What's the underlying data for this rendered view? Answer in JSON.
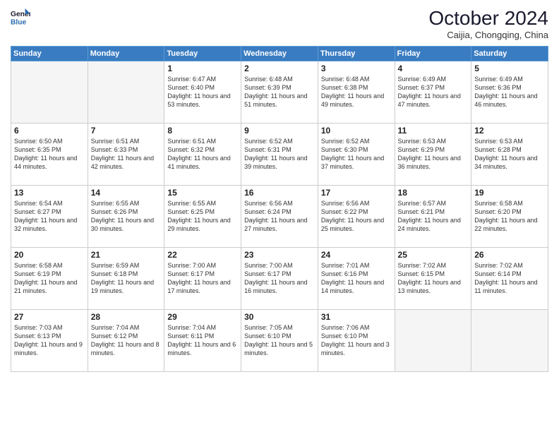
{
  "logo": {
    "line1": "General",
    "line2": "Blue"
  },
  "title": "October 2024",
  "subtitle": "Caijia, Chongqing, China",
  "days_header": [
    "Sunday",
    "Monday",
    "Tuesday",
    "Wednesday",
    "Thursday",
    "Friday",
    "Saturday"
  ],
  "weeks": [
    [
      {
        "day": "",
        "empty": true
      },
      {
        "day": "",
        "empty": true
      },
      {
        "day": "1",
        "sunrise": "Sunrise: 6:47 AM",
        "sunset": "Sunset: 6:40 PM",
        "daylight": "Daylight: 11 hours and 53 minutes."
      },
      {
        "day": "2",
        "sunrise": "Sunrise: 6:48 AM",
        "sunset": "Sunset: 6:39 PM",
        "daylight": "Daylight: 11 hours and 51 minutes."
      },
      {
        "day": "3",
        "sunrise": "Sunrise: 6:48 AM",
        "sunset": "Sunset: 6:38 PM",
        "daylight": "Daylight: 11 hours and 49 minutes."
      },
      {
        "day": "4",
        "sunrise": "Sunrise: 6:49 AM",
        "sunset": "Sunset: 6:37 PM",
        "daylight": "Daylight: 11 hours and 47 minutes."
      },
      {
        "day": "5",
        "sunrise": "Sunrise: 6:49 AM",
        "sunset": "Sunset: 6:36 PM",
        "daylight": "Daylight: 11 hours and 46 minutes."
      }
    ],
    [
      {
        "day": "6",
        "sunrise": "Sunrise: 6:50 AM",
        "sunset": "Sunset: 6:35 PM",
        "daylight": "Daylight: 11 hours and 44 minutes."
      },
      {
        "day": "7",
        "sunrise": "Sunrise: 6:51 AM",
        "sunset": "Sunset: 6:33 PM",
        "daylight": "Daylight: 11 hours and 42 minutes."
      },
      {
        "day": "8",
        "sunrise": "Sunrise: 6:51 AM",
        "sunset": "Sunset: 6:32 PM",
        "daylight": "Daylight: 11 hours and 41 minutes."
      },
      {
        "day": "9",
        "sunrise": "Sunrise: 6:52 AM",
        "sunset": "Sunset: 6:31 PM",
        "daylight": "Daylight: 11 hours and 39 minutes."
      },
      {
        "day": "10",
        "sunrise": "Sunrise: 6:52 AM",
        "sunset": "Sunset: 6:30 PM",
        "daylight": "Daylight: 11 hours and 37 minutes."
      },
      {
        "day": "11",
        "sunrise": "Sunrise: 6:53 AM",
        "sunset": "Sunset: 6:29 PM",
        "daylight": "Daylight: 11 hours and 36 minutes."
      },
      {
        "day": "12",
        "sunrise": "Sunrise: 6:53 AM",
        "sunset": "Sunset: 6:28 PM",
        "daylight": "Daylight: 11 hours and 34 minutes."
      }
    ],
    [
      {
        "day": "13",
        "sunrise": "Sunrise: 6:54 AM",
        "sunset": "Sunset: 6:27 PM",
        "daylight": "Daylight: 11 hours and 32 minutes."
      },
      {
        "day": "14",
        "sunrise": "Sunrise: 6:55 AM",
        "sunset": "Sunset: 6:26 PM",
        "daylight": "Daylight: 11 hours and 30 minutes."
      },
      {
        "day": "15",
        "sunrise": "Sunrise: 6:55 AM",
        "sunset": "Sunset: 6:25 PM",
        "daylight": "Daylight: 11 hours and 29 minutes."
      },
      {
        "day": "16",
        "sunrise": "Sunrise: 6:56 AM",
        "sunset": "Sunset: 6:24 PM",
        "daylight": "Daylight: 11 hours and 27 minutes."
      },
      {
        "day": "17",
        "sunrise": "Sunrise: 6:56 AM",
        "sunset": "Sunset: 6:22 PM",
        "daylight": "Daylight: 11 hours and 25 minutes."
      },
      {
        "day": "18",
        "sunrise": "Sunrise: 6:57 AM",
        "sunset": "Sunset: 6:21 PM",
        "daylight": "Daylight: 11 hours and 24 minutes."
      },
      {
        "day": "19",
        "sunrise": "Sunrise: 6:58 AM",
        "sunset": "Sunset: 6:20 PM",
        "daylight": "Daylight: 11 hours and 22 minutes."
      }
    ],
    [
      {
        "day": "20",
        "sunrise": "Sunrise: 6:58 AM",
        "sunset": "Sunset: 6:19 PM",
        "daylight": "Daylight: 11 hours and 21 minutes."
      },
      {
        "day": "21",
        "sunrise": "Sunrise: 6:59 AM",
        "sunset": "Sunset: 6:18 PM",
        "daylight": "Daylight: 11 hours and 19 minutes."
      },
      {
        "day": "22",
        "sunrise": "Sunrise: 7:00 AM",
        "sunset": "Sunset: 6:17 PM",
        "daylight": "Daylight: 11 hours and 17 minutes."
      },
      {
        "day": "23",
        "sunrise": "Sunrise: 7:00 AM",
        "sunset": "Sunset: 6:17 PM",
        "daylight": "Daylight: 11 hours and 16 minutes."
      },
      {
        "day": "24",
        "sunrise": "Sunrise: 7:01 AM",
        "sunset": "Sunset: 6:16 PM",
        "daylight": "Daylight: 11 hours and 14 minutes."
      },
      {
        "day": "25",
        "sunrise": "Sunrise: 7:02 AM",
        "sunset": "Sunset: 6:15 PM",
        "daylight": "Daylight: 11 hours and 13 minutes."
      },
      {
        "day": "26",
        "sunrise": "Sunrise: 7:02 AM",
        "sunset": "Sunset: 6:14 PM",
        "daylight": "Daylight: 11 hours and 11 minutes."
      }
    ],
    [
      {
        "day": "27",
        "sunrise": "Sunrise: 7:03 AM",
        "sunset": "Sunset: 6:13 PM",
        "daylight": "Daylight: 11 hours and 9 minutes."
      },
      {
        "day": "28",
        "sunrise": "Sunrise: 7:04 AM",
        "sunset": "Sunset: 6:12 PM",
        "daylight": "Daylight: 11 hours and 8 minutes."
      },
      {
        "day": "29",
        "sunrise": "Sunrise: 7:04 AM",
        "sunset": "Sunset: 6:11 PM",
        "daylight": "Daylight: 11 hours and 6 minutes."
      },
      {
        "day": "30",
        "sunrise": "Sunrise: 7:05 AM",
        "sunset": "Sunset: 6:10 PM",
        "daylight": "Daylight: 11 hours and 5 minutes."
      },
      {
        "day": "31",
        "sunrise": "Sunrise: 7:06 AM",
        "sunset": "Sunset: 6:10 PM",
        "daylight": "Daylight: 11 hours and 3 minutes."
      },
      {
        "day": "",
        "empty": true
      },
      {
        "day": "",
        "empty": true
      }
    ]
  ]
}
